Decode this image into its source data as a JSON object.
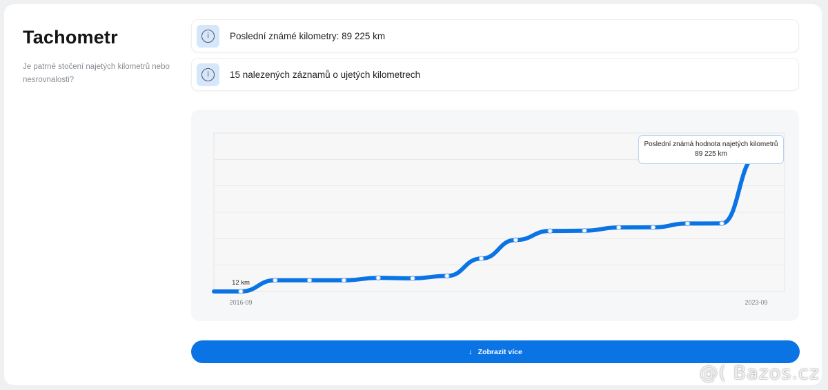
{
  "section": {
    "title": "Tachometr",
    "subtitle": "Je patrné stočení najetých kilometrů nebo nesrovnalosti?"
  },
  "info_rows": [
    {
      "icon": "info-icon",
      "text": "Poslední známé kilometry: 89 225 km"
    },
    {
      "icon": "info-icon",
      "text": "15 nalezených záznamů o ujetých kilometrech"
    }
  ],
  "chart_data": {
    "type": "line",
    "x_labels": [
      "2016-09",
      "2023-09"
    ],
    "first_point_label": "12 km",
    "tooltip": {
      "line1": "Poslední známá hodnota najetých kilometrů",
      "line2": "89 225 km"
    },
    "ylim": [
      0,
      105000
    ],
    "grid": "horizontal",
    "series_color": "#0b74e5",
    "values": [
      12,
      12,
      7400,
      7400,
      7400,
      9000,
      8700,
      10300,
      21800,
      34100,
      40100,
      40300,
      42400,
      42500,
      45000,
      45100,
      89225
    ]
  },
  "button": {
    "label": "Zobrazit více",
    "icon": "arrow-down-icon"
  },
  "watermark": "@( Bazos.cz"
}
